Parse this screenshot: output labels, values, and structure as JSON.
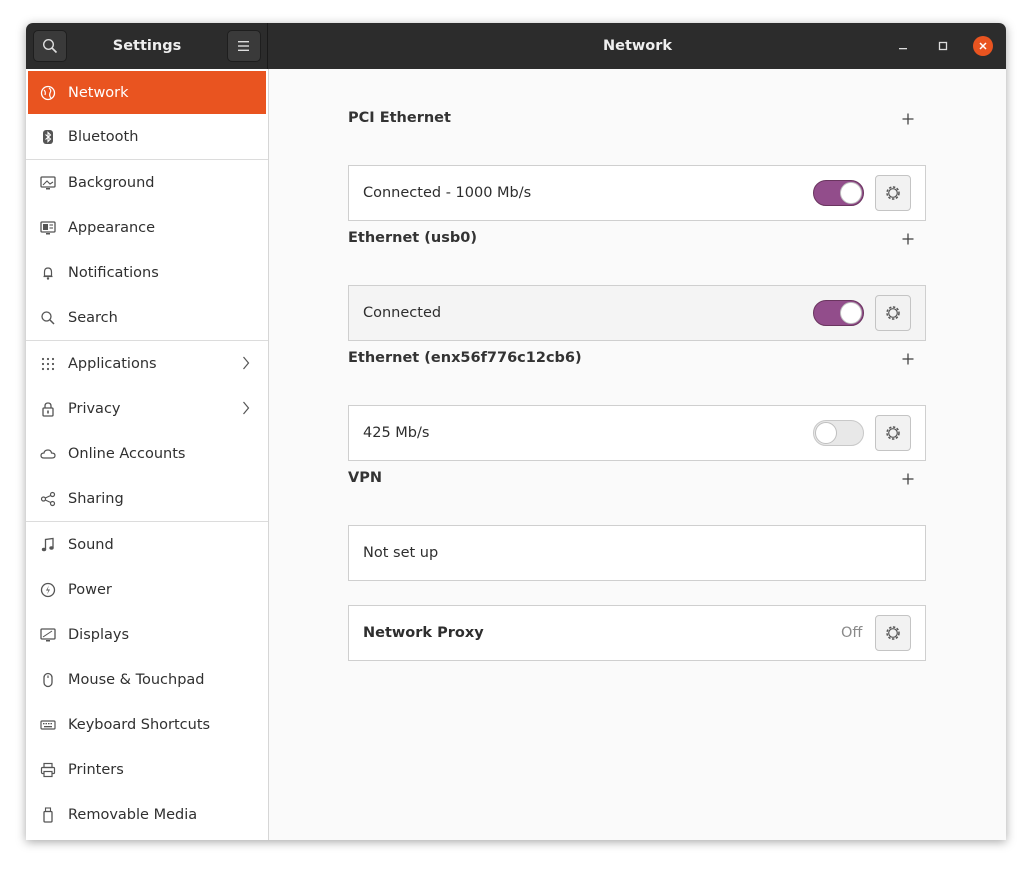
{
  "header": {
    "sidebar_title": "Settings",
    "page_title": "Network"
  },
  "sidebar": {
    "items": [
      {
        "label": "Network",
        "icon": "network-icon",
        "active": true
      },
      {
        "label": "Bluetooth",
        "icon": "bluetooth-icon"
      },
      {
        "label": "Background",
        "icon": "background-icon"
      },
      {
        "label": "Appearance",
        "icon": "appearance-icon"
      },
      {
        "label": "Notifications",
        "icon": "bell-icon"
      },
      {
        "label": "Search",
        "icon": "search-icon"
      },
      {
        "label": "Applications",
        "icon": "apps-grid-icon",
        "has_submenu": true
      },
      {
        "label": "Privacy",
        "icon": "lock-icon",
        "has_submenu": true
      },
      {
        "label": "Online Accounts",
        "icon": "cloud-icon"
      },
      {
        "label": "Sharing",
        "icon": "share-icon"
      },
      {
        "label": "Sound",
        "icon": "music-note-icon"
      },
      {
        "label": "Power",
        "icon": "power-icon"
      },
      {
        "label": "Displays",
        "icon": "display-icon"
      },
      {
        "label": "Mouse & Touchpad",
        "icon": "mouse-icon"
      },
      {
        "label": "Keyboard Shortcuts",
        "icon": "keyboard-icon"
      },
      {
        "label": "Printers",
        "icon": "printer-icon"
      },
      {
        "label": "Removable Media",
        "icon": "removable-media-icon"
      }
    ]
  },
  "main": {
    "sections": [
      {
        "title": "PCI Ethernet",
        "status": "Connected - 1000 Mb/s",
        "toggle_on": true
      },
      {
        "title": "Ethernet (usb0)",
        "status": "Connected",
        "toggle_on": true
      },
      {
        "title": "Ethernet (enx56f776c12cb6)",
        "status": "425 Mb/s",
        "toggle_on": false
      },
      {
        "title": "VPN",
        "status": "Not set up"
      }
    ],
    "proxy": {
      "label": "Network Proxy",
      "status": "Off"
    }
  },
  "colors": {
    "accent": "#e95420",
    "toggle_on": "#924d8b",
    "headerbar": "#2c2c2c"
  }
}
